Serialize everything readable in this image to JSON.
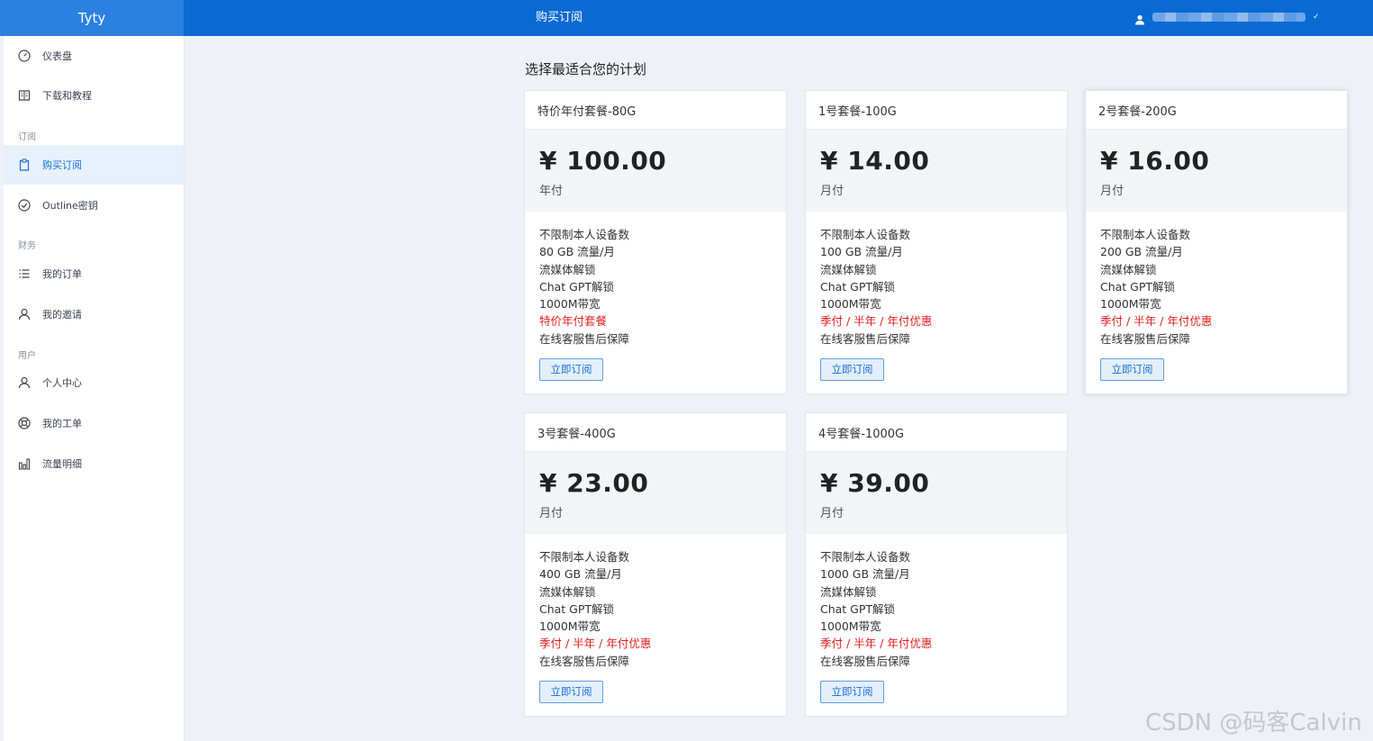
{
  "header": {
    "brand": "Tyty",
    "title": "购买订阅",
    "user_chevron": "✓"
  },
  "sidebar": {
    "items": [
      {
        "label": "仪表盘",
        "icon": "gauge-icon"
      },
      {
        "label": "下载和教程",
        "icon": "book-icon"
      },
      {
        "label": "购买订阅",
        "icon": "clipboard-icon",
        "active": true
      },
      {
        "label": "Outline密钥",
        "icon": "check-circle-icon"
      },
      {
        "label": "我的订单",
        "icon": "list-icon"
      },
      {
        "label": "我的邀请",
        "icon": "user-icon"
      },
      {
        "label": "个人中心",
        "icon": "user-icon"
      },
      {
        "label": "我的工单",
        "icon": "lifebuoy-icon"
      },
      {
        "label": "流量明细",
        "icon": "bar-chart-icon"
      }
    ],
    "sections": [
      "订阅",
      "财务",
      "用户"
    ]
  },
  "main": {
    "heading": "选择最适合您的计划",
    "subscribe_label": "立即订阅",
    "plans": [
      {
        "name": "特价年付套餐-80G",
        "price": "¥ 100.00",
        "period": "年付",
        "features": [
          "不限制本人设备数",
          "80 GB 流量/月",
          "流媒体解锁",
          "Chat GPT解锁",
          "1000M带宽",
          "特价年付套餐",
          "在线客服售后保障"
        ]
      },
      {
        "name": "1号套餐-100G",
        "price": "¥ 14.00",
        "period": "月付",
        "features": [
          "不限制本人设备数",
          "100 GB 流量/月",
          "流媒体解锁",
          "Chat GPT解锁",
          "1000M带宽",
          "季付 / 半年 / 年付优惠",
          "在线客服售后保障"
        ]
      },
      {
        "name": "2号套餐-200G",
        "price": "¥ 16.00",
        "period": "月付",
        "features": [
          "不限制本人设备数",
          "200 GB 流量/月",
          "流媒体解锁",
          "Chat GPT解锁",
          "1000M带宽",
          "季付 / 半年 / 年付优惠",
          "在线客服售后保障"
        ]
      },
      {
        "name": "3号套餐-400G",
        "price": "¥ 23.00",
        "period": "月付",
        "features": [
          "不限制本人设备数",
          "400 GB 流量/月",
          "流媒体解锁",
          "Chat GPT解锁",
          "1000M带宽",
          "季付 / 半年 / 年付优惠",
          "在线客服售后保障"
        ]
      },
      {
        "name": "4号套餐-1000G",
        "price": "¥ 39.00",
        "period": "月付",
        "features": [
          "不限制本人设备数",
          "1000 GB 流量/月",
          "流媒体解锁",
          "Chat GPT解锁",
          "1000M带宽",
          "季付 / 半年 / 年付优惠",
          "在线客服售后保障"
        ]
      }
    ]
  },
  "watermark": "CSDN @码客Calvin",
  "colors": {
    "header": "#0a6ad3",
    "brand_bg": "#2c80e0",
    "promo_text": "#e02020",
    "active_nav": "#1a6fd6"
  }
}
